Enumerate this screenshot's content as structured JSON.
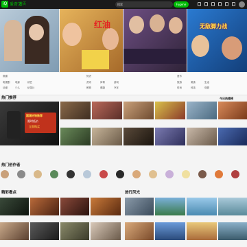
{
  "brand": {
    "logo_glyph": "iQ",
    "name": "爱奇艺",
    "accent": "#00be06"
  },
  "nav": {
    "link": "首页"
  },
  "search": {
    "placeholder": "搜索",
    "button": "Fugene"
  },
  "hero": {
    "banners": [
      {
        "caption": "",
        "bg": "#9fb6c9"
      },
      {
        "caption": "",
        "overlay": "红油",
        "bg": "#d9a14a"
      },
      {
        "caption": "",
        "bg": "#5b3d6e"
      },
      {
        "caption": "",
        "overlay": "无敌脚力战",
        "bg": "#c92a2a"
      }
    ]
  },
  "categories": {
    "col1": [
      "频道",
      "电视剧",
      "电影",
      "综艺",
      "动漫",
      "少儿",
      "纪录片"
    ],
    "col2": [
      "知识",
      "资讯",
      "体育",
      "游戏",
      "教育",
      "健康",
      "汽车"
    ],
    "col3": [
      "音乐",
      "旅游",
      "美食",
      "生活",
      "时尚",
      "科技",
      "母婴"
    ]
  },
  "sections": {
    "s1": {
      "title": "热门推荐"
    },
    "s1_right": {
      "title": "今日热播榜"
    },
    "s2": {
      "title": "热门创作者"
    },
    "s3_left": {
      "title": "精彩看点"
    },
    "s3_right": {
      "title": "旅行风光"
    }
  },
  "promo": {
    "line1": "国潮好物推荐",
    "line2": "限时低价",
    "line3": "立即购买"
  },
  "creators": [
    "",
    "",
    "",
    "",
    "",
    "",
    "",
    "",
    "",
    "",
    "",
    "",
    "",
    "",
    ""
  ]
}
